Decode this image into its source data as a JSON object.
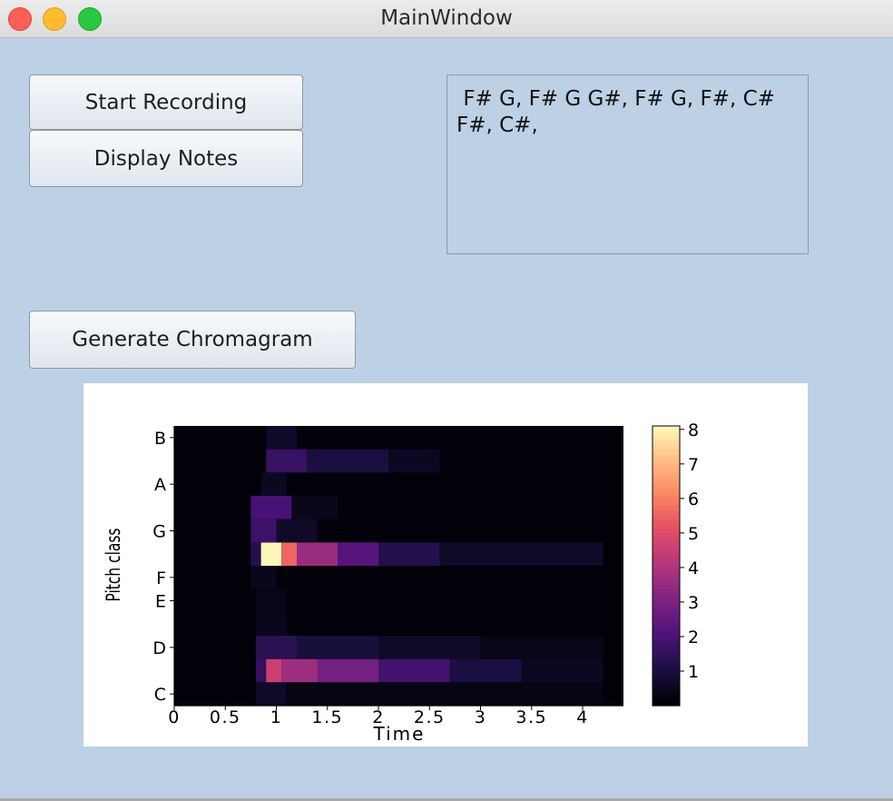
{
  "window": {
    "title": "MainWindow"
  },
  "buttons": {
    "start_recording": "Start Recording",
    "display_notes": "Display Notes",
    "generate_chromagram": "Generate Chromagram"
  },
  "notes_output": {
    "text": " F# G, F# G G#, F# G, F#, C#\nF#, C#,"
  },
  "colors": {
    "background": "#bcd1e5",
    "close": "#fe5f57",
    "minimize": "#febc2e",
    "zoom": "#28c840"
  },
  "chart_data": {
    "type": "heatmap",
    "colormap": "magma",
    "xlabel": "Time",
    "ylabel": "Pitch class",
    "x_ticks": [
      "0",
      "0.5",
      "1",
      "1.5",
      "2",
      "2.5",
      "3",
      "3.5",
      "4"
    ],
    "x_tick_values": [
      0,
      0.5,
      1,
      1.5,
      2,
      2.5,
      3,
      3.5,
      4
    ],
    "xlim": [
      0,
      4.4
    ],
    "y_ticks": [
      "C",
      "D",
      "E",
      "F",
      "G",
      "A",
      "B"
    ],
    "y_tick_bins": [
      0,
      2,
      4,
      5,
      7,
      9,
      11
    ],
    "pitch_bins": 12,
    "colorbar": {
      "ticks": [
        "1",
        "2",
        "3",
        "4",
        "5",
        "6",
        "7",
        "8"
      ],
      "tick_values": [
        1,
        2,
        3,
        4,
        5,
        6,
        7,
        8
      ],
      "range": [
        0,
        8.1
      ]
    },
    "bands": [
      {
        "pitch_bin": 6,
        "segments": [
          [
            0.75,
            0.85,
            1.2
          ],
          [
            0.85,
            1.05,
            8.0
          ],
          [
            1.05,
            1.2,
            5.5
          ],
          [
            1.2,
            1.6,
            3.5
          ],
          [
            1.6,
            2.0,
            2.2
          ],
          [
            2.0,
            2.6,
            1.2
          ],
          [
            2.6,
            4.2,
            0.6
          ]
        ]
      },
      {
        "pitch_bin": 1,
        "segments": [
          [
            0.8,
            0.9,
            1.5
          ],
          [
            0.9,
            1.05,
            4.5
          ],
          [
            1.05,
            1.4,
            3.6
          ],
          [
            1.4,
            2.0,
            2.8
          ],
          [
            2.0,
            2.7,
            1.8
          ],
          [
            2.7,
            3.4,
            1.0
          ],
          [
            3.4,
            4.2,
            0.5
          ]
        ]
      },
      {
        "pitch_bin": 2,
        "segments": [
          [
            0.8,
            1.2,
            1.3
          ],
          [
            1.2,
            2.0,
            0.9
          ],
          [
            2.0,
            3.0,
            0.6
          ],
          [
            3.0,
            4.2,
            0.3
          ]
        ]
      },
      {
        "pitch_bin": 10,
        "segments": [
          [
            0.9,
            1.3,
            1.6
          ],
          [
            1.3,
            2.1,
            1.0
          ],
          [
            2.1,
            2.6,
            0.5
          ]
        ]
      },
      {
        "pitch_bin": 8,
        "segments": [
          [
            0.75,
            1.15,
            1.9
          ],
          [
            1.15,
            1.6,
            0.4
          ]
        ]
      },
      {
        "pitch_bin": 7,
        "segments": [
          [
            0.75,
            1.0,
            1.7
          ],
          [
            1.0,
            1.4,
            0.6
          ]
        ]
      },
      {
        "pitch_bin": 9,
        "segments": [
          [
            0.85,
            1.1,
            0.5
          ]
        ]
      },
      {
        "pitch_bin": 0,
        "segments": [
          [
            0.8,
            1.1,
            0.6
          ],
          [
            1.1,
            4.2,
            0.25
          ]
        ]
      },
      {
        "pitch_bin": 5,
        "segments": [
          [
            0.75,
            1.0,
            0.4
          ]
        ]
      },
      {
        "pitch_bin": 11,
        "segments": [
          [
            0.9,
            1.2,
            0.6
          ]
        ]
      },
      {
        "pitch_bin": 3,
        "segments": [
          [
            0.8,
            1.1,
            0.4
          ]
        ]
      },
      {
        "pitch_bin": 4,
        "segments": [
          [
            0.8,
            1.1,
            0.3
          ]
        ]
      }
    ]
  }
}
